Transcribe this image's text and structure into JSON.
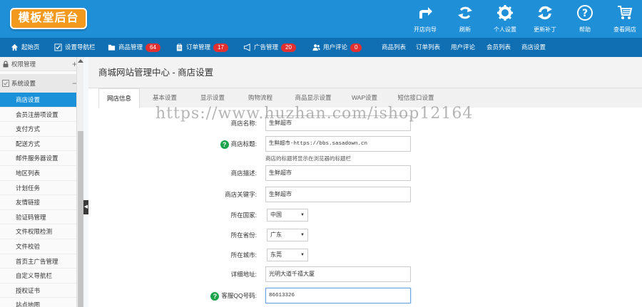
{
  "app": {
    "logo_text": "模板堂后台"
  },
  "toolbar": [
    {
      "label": "开店向导",
      "icon": "forward-arrow-icon"
    },
    {
      "label": "刷新",
      "icon": "refresh-icon"
    },
    {
      "label": "个人设置",
      "icon": "gear-icon"
    },
    {
      "label": "更新补丁",
      "icon": "update-icon"
    },
    {
      "label": "帮助",
      "icon": "help-circle-icon"
    },
    {
      "label": "查看网店",
      "icon": "cart-icon"
    }
  ],
  "nav": {
    "home": "起始页",
    "settings_nav": "设置导航栏",
    "goods": "商品管理",
    "goods_count": "64",
    "orders": "订单管理",
    "orders_count": "17",
    "ads": "广告管理",
    "ads_count": "20",
    "comments": "用户评论",
    "comments_count": "0",
    "quick_links": [
      "商品列表",
      "订单列表",
      "用户评论",
      "会员列表",
      "商店设置"
    ]
  },
  "sidebar": {
    "group_permissions": "权限管理",
    "group_system": "系统设置",
    "items": [
      "商店设置",
      "会员注册项设置",
      "支付方式",
      "配送方式",
      "邮件服务器设置",
      "地区列表",
      "计划任务",
      "友情链接",
      "验证码管理",
      "文件权限检测",
      "文件校验",
      "首页主广告管理",
      "自定义导航栏",
      "授权证书",
      "站点地图"
    ]
  },
  "page": {
    "title": "商城网站管理中心 - 商店设置",
    "tabs": [
      "网店信息",
      "基本设置",
      "显示设置",
      "购物流程",
      "商品显示设置",
      "WAP设置",
      "短信接口设置"
    ]
  },
  "form": {
    "shop_name_label": "商店名称:",
    "shop_name_value": "生鲜超市",
    "shop_title_label": "商店标题:",
    "shop_title_value": "生鲜超市-https://bbs.sasadown.cn",
    "shop_title_hint": "商店的标题将显示在浏览器的标题栏",
    "shop_desc_label": "商店描述:",
    "shop_desc_value": "生鲜超市",
    "shop_keywords_label": "商店关键字:",
    "shop_keywords_value": "生鲜超市",
    "country_label": "所在国家:",
    "country_value": "中国",
    "province_label": "所在省份:",
    "province_value": "广东",
    "city_label": "所在城市:",
    "city_value": "东莞",
    "address_label": "详细地址:",
    "address_value": "光明大道千禧大厦",
    "qq_label": "客服QQ号码:",
    "qq_value": "86613326"
  },
  "watermark": "https://www.huzhan.com/ishop12164",
  "colors": {
    "header": "#1f8fd8",
    "nav": "#0f6fb2",
    "logo": "#f39a1e",
    "badge": "#e23030",
    "active": "#1a91d8",
    "help": "#1aa34a"
  }
}
